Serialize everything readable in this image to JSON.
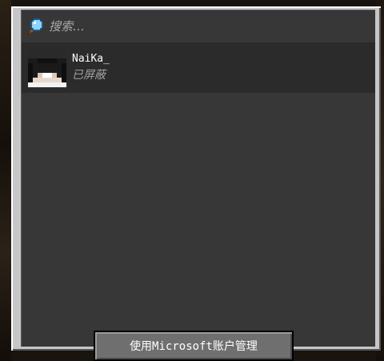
{
  "search": {
    "placeholder": "搜索…",
    "icon": "magnifier-icon"
  },
  "players": [
    {
      "name": "NaiKa_",
      "status": "已屏蔽",
      "avatar": "player-head-icon"
    }
  ],
  "footer": {
    "manage_button_label": "使用Microsoft账户管理"
  },
  "colors": {
    "frame": "#c6c6c6",
    "panel_bg": "#373737",
    "row_bg": "#2b2b2b",
    "button_bg": "#6f6f6f",
    "text_primary": "#ffffff",
    "text_muted": "#a8a8a8"
  }
}
